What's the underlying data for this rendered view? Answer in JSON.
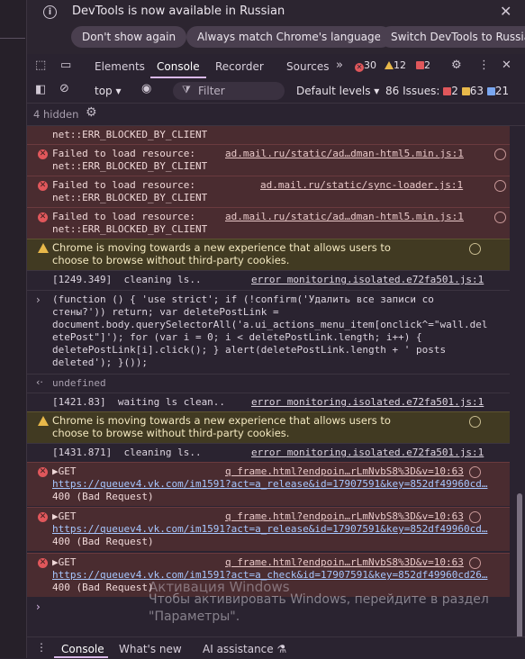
{
  "infobar": {
    "message": "DevTools is now available in Russian",
    "buttons": [
      "Don't show again",
      "Always match Chrome's language",
      "Switch DevTools to Russian"
    ]
  },
  "tabs": [
    "Elements",
    "Console",
    "Recorder",
    "Sources"
  ],
  "active_tab": "Console",
  "counts": {
    "errors": "30",
    "warnings": "12",
    "issues": "2"
  },
  "toolbar": {
    "context": "top",
    "filter_placeholder": "Filter",
    "levels": "Default levels",
    "issues_label": "86 Issues:",
    "issue_counts": {
      "errors": "2",
      "warnings": "63",
      "info": "21"
    },
    "hidden": "4 hidden"
  },
  "log": [
    {
      "type": "error",
      "text2": "net::ERR_BLOCKED_BY_CLIENT"
    },
    {
      "type": "error",
      "text": "Failed to load resource:",
      "text2": "net::ERR_BLOCKED_BY_CLIENT",
      "source": "ad.mail.ru/static/ad…dman-html5.min.js:1"
    },
    {
      "type": "error",
      "text": "Failed to load resource:",
      "text2": "net::ERR_BLOCKED_BY_CLIENT",
      "source": "ad.mail.ru/static/sync-loader.js:1"
    },
    {
      "type": "error",
      "text": "Failed to load resource:",
      "text2": "net::ERR_BLOCKED_BY_CLIENT",
      "source": "ad.mail.ru/static/ad…dman-html5.min.js:1"
    },
    {
      "type": "warn",
      "text": "Chrome is moving towards a new experience that allows users to",
      "text2": "choose to browse without third-party cookies."
    },
    {
      "type": "plain",
      "text": "[1249.349]  cleaning ls..",
      "source": "error monitoring.isolated.e72fa501.js:1"
    },
    {
      "type": "code",
      "lines": [
        "(function () { 'use strict'; if (!confirm('Удалить все записи со",
        "стены?')) return; var deletePostLink =",
        "document.body.querySelectorAll('a.ui_actions_menu_item[onclick^=\"wall.del",
        "etePost\"]'); for (var i = 0; i < deletePostLink.length; i++) {",
        "deletePostLink[i].click(); } alert(deletePostLink.length + ' posts",
        "deleted'); }());"
      ]
    },
    {
      "type": "result",
      "text": "undefined"
    },
    {
      "type": "plain",
      "text": "[1421.83]  waiting ls clean..",
      "source": "error monitoring.isolated.e72fa501.js:1"
    },
    {
      "type": "warn",
      "text": "Chrome is moving towards a new experience that allows users to",
      "text2": "choose to browse without third-party cookies."
    },
    {
      "type": "plain",
      "text": "[1431.871]  cleaning ls..",
      "source": "error monitoring.isolated.e72fa501.js:1"
    },
    {
      "type": "error",
      "text": "▶GET",
      "source": "q frame.html?endpoin…rLmNvbS8%3D&v=10:63",
      "url": "https://queuev4.vk.com/im1591?act=a_release&id=17907591&key=852df49960cd…",
      "text2": "400 (Bad Request)"
    },
    {
      "type": "error",
      "text": "▶GET",
      "source": "q frame.html?endpoin…rLmNvbS8%3D&v=10:63",
      "url": "https://queuev4.vk.com/im1591?act=a_release&id=17907591&key=852df49960cd…",
      "text2": "400 (Bad Request)"
    },
    {
      "type": "error",
      "text": "▶GET",
      "source": "q frame.html?endpoin…rLmNvbS8%3D&v=10:63",
      "url": "https://queuev4.vk.com/im1591?act=a_check&id=17907591&key=852df49960cd26…",
      "text2": "400 (Bad Request)"
    }
  ],
  "watermark": {
    "line1": "Активация Windows",
    "line2": "Чтобы активировать Windows, перейдите в раздел",
    "line3": "\"Параметры\"."
  },
  "drawer": [
    "Console",
    "What's new",
    "AI assistance"
  ]
}
